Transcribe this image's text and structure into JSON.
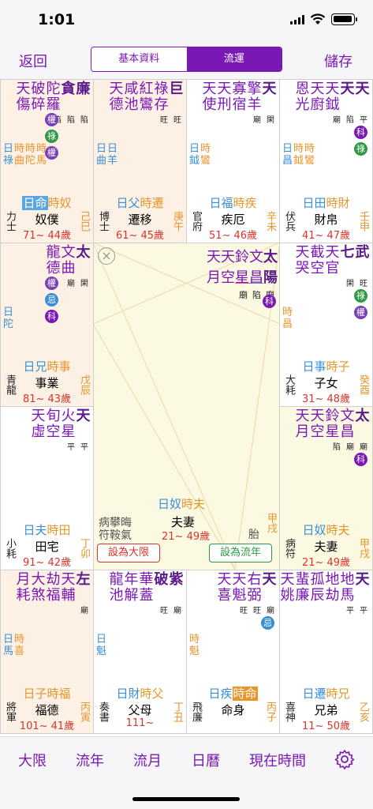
{
  "status": {
    "time": "1:01"
  },
  "nav": {
    "back": "返回",
    "save": "儲存",
    "seg_basic": "基本資料",
    "seg_flow": "流運"
  },
  "tabs": [
    "大限",
    "流年",
    "流月",
    "日曆",
    "現在時間"
  ],
  "colors": {
    "accent": "#7a18b5",
    "main_star": "#5a1a8a",
    "orange": "#e8952a",
    "blue": "#3a8fd4",
    "red": "#d9342b",
    "green": "#2f9a45",
    "quan": "#7a3fb5",
    "lu": "#2f9a45",
    "ji": "#3a8fd4",
    "ke": "#7a18b5"
  },
  "center": {
    "stars": [
      "天",
      "天",
      "鈴",
      "文",
      "太"
    ],
    "stars2": [
      "月",
      "空",
      "星",
      "昌",
      "陽"
    ],
    "status": [
      "廟",
      "陷",
      "廟"
    ],
    "ke": "科",
    "top_left_palace": "日奴",
    "top_right_palace": "時夫",
    "gods1": "病攀晦",
    "gods2": "符鞍氣",
    "name": "夫妻",
    "ages": "21~ 49歲",
    "stem_r": "甲戌",
    "taisui": "胎",
    "btn_daxian": "設為大限",
    "btn_liunian": "設為流年"
  },
  "cells": [
    {
      "id": "c00",
      "main": [
        "廉",
        "貪"
      ],
      "minor": [
        "陀",
        "破",
        "天"
      ],
      "minor2": [
        "羅",
        "碎",
        "傷"
      ],
      "st": [
        "陷",
        "陷",
        "陷"
      ],
      "hua": [
        [
          "權",
          "quan"
        ],
        [
          "祿",
          "lu"
        ],
        [
          "權",
          "quan"
        ]
      ],
      "v": [
        "日",
        "時",
        "時",
        "時"
      ],
      "v2": [
        "祿",
        "曲",
        "陀",
        "馬"
      ],
      "lab": [
        [
          "日命",
          "blue"
        ],
        [
          "時奴",
          "orange"
        ]
      ],
      "name": "奴僕",
      "l": "力士",
      "a": "71~ 44歲",
      "r": "己巳"
    },
    {
      "id": "c01",
      "main": [
        "巨"
      ],
      "minor": [
        "祿",
        "紅",
        "咸",
        "天"
      ],
      "minor2": [
        "存",
        "鸞",
        "池",
        "德"
      ],
      "st": [
        "旺",
        "旺"
      ],
      "v": [
        "日",
        "日"
      ],
      "v2": [
        "曲",
        "羊"
      ],
      "lab": [
        [
          "日父",
          "blue"
        ],
        [
          "時遷",
          "orange"
        ]
      ],
      "name": "遷移",
      "l": "博士",
      "a": "61~ 45歲",
      "r": "庚午"
    },
    {
      "id": "c02",
      "main": [
        "天"
      ],
      "minor": [
        "擎",
        "寡",
        "天",
        "天"
      ],
      "minor2": [
        "羊",
        "宿",
        "刑",
        "使"
      ],
      "st": [
        "廟",
        "閑"
      ],
      "v": [
        "日",
        "時"
      ],
      "v2": [
        "鉞",
        "鸞"
      ],
      "lab": [
        [
          "日福",
          "blue"
        ],
        [
          "時疾",
          "orange"
        ]
      ],
      "name": "疾厄",
      "l": "官府",
      "a": "51~ 46歲",
      "r": "辛未"
    },
    {
      "id": "c03",
      "main": [
        "天",
        "天"
      ],
      "minor": [
        "天",
        "天",
        "恩"
      ],
      "minor2": [
        "鉞",
        "廚",
        "光"
      ],
      "st": [
        "廟",
        "陷",
        "平"
      ],
      "hua": [
        [
          "科",
          "ke"
        ],
        [
          "祿",
          "lu"
        ]
      ],
      "v": [
        "日",
        "時",
        "時"
      ],
      "v2": [
        "昌",
        "鉞",
        "鸞"
      ],
      "lab": [
        [
          "日田",
          "blue"
        ],
        [
          "時財",
          "orange"
        ]
      ],
      "name": "財帛",
      "l": "伏兵",
      "a": "41~ 47歲",
      "r": "壬申"
    },
    {
      "id": "c10",
      "main": [
        "太"
      ],
      "minor": [
        "文",
        "龍"
      ],
      "minor2": [
        "曲",
        "德"
      ],
      "st": [
        "廟",
        "閑"
      ],
      "hua": [
        [
          "權",
          "quan"
        ],
        [
          "忌",
          "ji"
        ],
        [
          "科",
          "ke"
        ]
      ],
      "v": [
        "日"
      ],
      "v2": [
        "陀"
      ],
      "lab": [
        [
          "日兄",
          "blue"
        ],
        [
          "時事",
          "orange"
        ]
      ],
      "name": "事業",
      "l": "青龍",
      "a": "81~ 43歲",
      "r": "戊辰"
    },
    {
      "id": "c13",
      "main": [
        "武",
        "七"
      ],
      "minor": [
        "天",
        "截",
        "天"
      ],
      "minor2": [
        "官",
        "空",
        "哭"
      ],
      "st": [
        "閑",
        "旺"
      ],
      "hua": [
        [
          "祿",
          "lu"
        ],
        [
          "權",
          "quan"
        ]
      ],
      "v": [
        "時"
      ],
      "v2": [
        "昌"
      ],
      "lab": [
        [
          "日事",
          "blue"
        ],
        [
          "時子",
          "orange"
        ]
      ],
      "name": "子女",
      "l": "大耗",
      "a": "31~ 48歲",
      "r": "癸酉"
    },
    {
      "id": "c20",
      "main": [
        "天"
      ],
      "minor": [
        "火",
        "旬",
        "天"
      ],
      "minor2": [
        "星",
        "空",
        "虛"
      ],
      "st": [
        "平",
        "平"
      ],
      "v": [],
      "v2": [],
      "lab": [
        [
          "日夫",
          "blue"
        ],
        [
          "時田",
          "orange"
        ]
      ],
      "name": "田宅",
      "l": "小耗",
      "a": "91~ 42歲",
      "r": "丁卯"
    },
    {
      "id": "c23",
      "main": [
        "太"
      ],
      "minor": [
        "文",
        "鈴",
        "天",
        "天"
      ],
      "minor2": [
        "昌",
        "星",
        "空",
        "月"
      ],
      "st": [
        "陷",
        "廟",
        "廟"
      ],
      "hua": [
        [
          "科",
          "ke"
        ]
      ],
      "v": [],
      "v2": [],
      "lab": [
        [
          "日奴",
          "blue"
        ],
        [
          "時夫",
          "orange"
        ]
      ],
      "name": "夫妻",
      "l": "病符",
      "a": "21~ 49歲",
      "r": "甲戌"
    },
    {
      "id": "c30",
      "main": [
        "左"
      ],
      "minor": [
        "天",
        "劫",
        "大",
        "月"
      ],
      "minor2": [
        "輔",
        "福",
        "煞",
        "耗",
        "德"
      ],
      "st": [
        "廟"
      ],
      "v": [
        "日",
        "時"
      ],
      "v2": [
        "馬",
        "喜"
      ],
      "lab": [
        [
          "日子",
          "orange"
        ],
        [
          "時福",
          "orange"
        ]
      ],
      "name": "福德",
      "l": "將軍",
      "a": "101~ 41歲",
      "r": "丙寅"
    },
    {
      "id": "c31",
      "main": [
        "紫",
        "破"
      ],
      "minor": [
        "華",
        "年",
        "龍"
      ],
      "minor2": [
        "蓋",
        "解",
        "池"
      ],
      "st": [
        "旺",
        "廟"
      ],
      "v": [
        "日"
      ],
      "v2": [
        "魁"
      ],
      "lab": [
        [
          "日財",
          "blue"
        ],
        [
          "時父",
          "orange"
        ]
      ],
      "name": "父母",
      "l": "奏書",
      "a": "111~",
      "r": "丁丑"
    },
    {
      "id": "c32",
      "main": [
        "天"
      ],
      "minor": [
        "右",
        "天",
        "天"
      ],
      "minor2": [
        "弼",
        "魁",
        "喜"
      ],
      "st": [
        "旺",
        "旺",
        "廟"
      ],
      "hua": [
        [
          "忌",
          "ji"
        ]
      ],
      "v": [
        "時"
      ],
      "v2": [
        "魁"
      ],
      "lab": [
        [
          "日疾",
          "blue"
        ],
        [
          "時命",
          "orange"
        ]
      ],
      "name": "命身",
      "l": "飛廉",
      "a": "",
      "r": "丙子"
    },
    {
      "id": "c33",
      "main": [
        "天"
      ],
      "minor": [
        "地",
        "地",
        "孤",
        "蜚",
        "天"
      ],
      "minor2": [
        "馬",
        "劫",
        "辰",
        "廉",
        "姚"
      ],
      "st": [
        "平",
        "平"
      ],
      "v": [],
      "v2": [],
      "lab": [
        [
          "日遷",
          "blue"
        ],
        [
          "時兄",
          "orange"
        ]
      ],
      "name": "兄弟",
      "l": "喜神",
      "a": "11~ 50歲",
      "r": "乙亥"
    }
  ]
}
